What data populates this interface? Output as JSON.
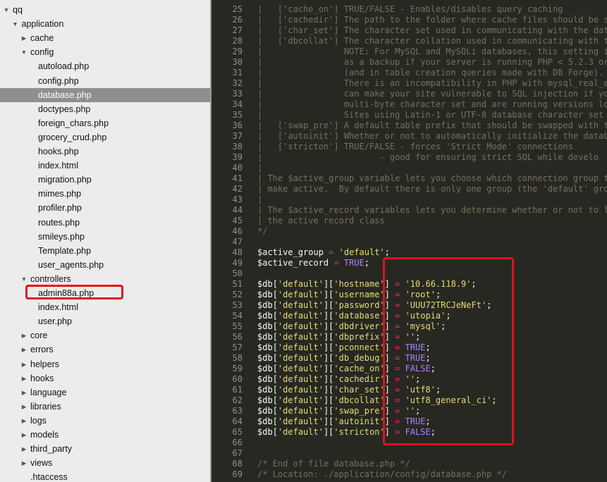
{
  "sidebar": {
    "rows": [
      {
        "label": "qq",
        "tri": "open",
        "depth": 0
      },
      {
        "label": "application",
        "tri": "open",
        "depth": 1
      },
      {
        "label": "cache",
        "tri": "closed",
        "depth": 2
      },
      {
        "label": "config",
        "tri": "open",
        "depth": 2
      },
      {
        "label": "autoload.php",
        "tri": "",
        "depth": 3
      },
      {
        "label": "config.php",
        "tri": "",
        "depth": 3
      },
      {
        "label": "database.php",
        "tri": "",
        "depth": 3,
        "selected": true
      },
      {
        "label": "doctypes.php",
        "tri": "",
        "depth": 3
      },
      {
        "label": "foreign_chars.php",
        "tri": "",
        "depth": 3
      },
      {
        "label": "grocery_crud.php",
        "tri": "",
        "depth": 3
      },
      {
        "label": "hooks.php",
        "tri": "",
        "depth": 3
      },
      {
        "label": "index.html",
        "tri": "",
        "depth": 3
      },
      {
        "label": "migration.php",
        "tri": "",
        "depth": 3
      },
      {
        "label": "mimes.php",
        "tri": "",
        "depth": 3
      },
      {
        "label": "profiler.php",
        "tri": "",
        "depth": 3
      },
      {
        "label": "routes.php",
        "tri": "",
        "depth": 3
      },
      {
        "label": "smileys.php",
        "tri": "",
        "depth": 3
      },
      {
        "label": "Template.php",
        "tri": "",
        "depth": 3
      },
      {
        "label": "user_agents.php",
        "tri": "",
        "depth": 3
      },
      {
        "label": "controllers",
        "tri": "open",
        "depth": 2
      },
      {
        "label": "admin88a.php",
        "tri": "",
        "depth": 3,
        "highlighted": true
      },
      {
        "label": "index.html",
        "tri": "",
        "depth": 3
      },
      {
        "label": "user.php",
        "tri": "",
        "depth": 3
      },
      {
        "label": "core",
        "tri": "closed",
        "depth": 2
      },
      {
        "label": "errors",
        "tri": "closed",
        "depth": 2
      },
      {
        "label": "helpers",
        "tri": "closed",
        "depth": 2
      },
      {
        "label": "hooks",
        "tri": "closed",
        "depth": 2
      },
      {
        "label": "language",
        "tri": "closed",
        "depth": 2
      },
      {
        "label": "libraries",
        "tri": "closed",
        "depth": 2
      },
      {
        "label": "logs",
        "tri": "closed",
        "depth": 2
      },
      {
        "label": "models",
        "tri": "closed",
        "depth": 2
      },
      {
        "label": "third_party",
        "tri": "closed",
        "depth": 2
      },
      {
        "label": "views",
        "tri": "closed",
        "depth": 2
      },
      {
        "label": ".htaccess",
        "tri": "",
        "depth": 2
      }
    ]
  },
  "editor": {
    "lines": [
      {
        "n": "25",
        "segs": [
          [
            "c",
            "|   ['cache_on'] TRUE/FALSE - Enables/disables query caching"
          ]
        ]
      },
      {
        "n": "26",
        "segs": [
          [
            "c",
            "|   ['cachedir'] The path to the folder where cache files should be sto"
          ]
        ]
      },
      {
        "n": "27",
        "segs": [
          [
            "c",
            "|   ['char_set'] The character set used in communicating with the datab"
          ]
        ]
      },
      {
        "n": "28",
        "segs": [
          [
            "c",
            "|   ['dbcollat'] The character collation used in communicating with the"
          ]
        ]
      },
      {
        "n": "29",
        "segs": [
          [
            "c",
            "|                NOTE: For MySQL and MySQLi databases, this setting is"
          ]
        ]
      },
      {
        "n": "30",
        "segs": [
          [
            "c",
            "|                as a backup if your server is running PHP < 5.2.3 or M"
          ]
        ]
      },
      {
        "n": "31",
        "segs": [
          [
            "c",
            "|                (and in table creation queries made with DB Forge)."
          ]
        ]
      },
      {
        "n": "32",
        "segs": [
          [
            "c",
            "|                There is an incompatibility in PHP with mysql_real_esc"
          ]
        ]
      },
      {
        "n": "33",
        "segs": [
          [
            "c",
            "|                can make your site vulnerable to SQL injection if you"
          ]
        ]
      },
      {
        "n": "34",
        "segs": [
          [
            "c",
            "|                multi-byte character set and are running versions lowe"
          ]
        ]
      },
      {
        "n": "35",
        "segs": [
          [
            "c",
            "|                Sites using Latin-1 or UTF-8 database character set an"
          ]
        ]
      },
      {
        "n": "36",
        "segs": [
          [
            "c",
            "|   ['swap_pre'] A default table prefix that should be swapped with the"
          ]
        ]
      },
      {
        "n": "37",
        "segs": [
          [
            "c",
            "|   ['autoinit'] Whether or not to automatically initialize the databas"
          ]
        ]
      },
      {
        "n": "38",
        "segs": [
          [
            "c",
            "|   ['stricton'] TRUE/FALSE - forces 'Strict Mode' connections"
          ]
        ]
      },
      {
        "n": "39",
        "segs": [
          [
            "c",
            "|                       - good for ensuring strict SQL while develo"
          ]
        ]
      },
      {
        "n": "40",
        "segs": [
          [
            "c",
            "|"
          ]
        ]
      },
      {
        "n": "41",
        "segs": [
          [
            "c",
            "| The $active_group variable lets you choose which connection group to"
          ]
        ]
      },
      {
        "n": "42",
        "segs": [
          [
            "c",
            "| make active.  By default there is only one group (the 'default' group"
          ]
        ]
      },
      {
        "n": "43",
        "segs": [
          [
            "c",
            "|"
          ]
        ]
      },
      {
        "n": "44",
        "segs": [
          [
            "c",
            "| The $active_record variables lets you determine whether or not to loa"
          ]
        ]
      },
      {
        "n": "45",
        "segs": [
          [
            "c",
            "| the active record class"
          ]
        ]
      },
      {
        "n": "46",
        "segs": [
          [
            "c",
            "*/"
          ]
        ]
      },
      {
        "n": "47",
        "segs": []
      },
      {
        "n": "48",
        "segs": [
          [
            "v",
            "$active_group "
          ],
          [
            "o",
            "="
          ],
          [
            "p",
            " "
          ],
          [
            "s",
            "'default'"
          ],
          [
            "p",
            ";"
          ]
        ]
      },
      {
        "n": "49",
        "segs": [
          [
            "v",
            "$active_record "
          ],
          [
            "o",
            "="
          ],
          [
            "p",
            " "
          ],
          [
            "k",
            "TRUE"
          ],
          [
            "p",
            ";"
          ]
        ]
      },
      {
        "n": "50",
        "segs": []
      },
      {
        "n": "51",
        "segs": [
          [
            "v",
            "$db"
          ],
          [
            "p",
            "["
          ],
          [
            "s",
            "'default'"
          ],
          [
            "p",
            "]["
          ],
          [
            "s",
            "'hostname'"
          ],
          [
            "p",
            "] "
          ],
          [
            "o",
            "="
          ],
          [
            "p",
            " "
          ],
          [
            "s",
            "'10.66.118.9'"
          ],
          [
            "p",
            ";"
          ]
        ]
      },
      {
        "n": "52",
        "segs": [
          [
            "v",
            "$db"
          ],
          [
            "p",
            "["
          ],
          [
            "s",
            "'default'"
          ],
          [
            "p",
            "]["
          ],
          [
            "s",
            "'username'"
          ],
          [
            "p",
            "] "
          ],
          [
            "o",
            "="
          ],
          [
            "p",
            " "
          ],
          [
            "s",
            "'root'"
          ],
          [
            "p",
            ";"
          ]
        ]
      },
      {
        "n": "53",
        "segs": [
          [
            "v",
            "$db"
          ],
          [
            "p",
            "["
          ],
          [
            "s",
            "'default'"
          ],
          [
            "p",
            "]["
          ],
          [
            "s",
            "'password'"
          ],
          [
            "p",
            "] "
          ],
          [
            "o",
            "="
          ],
          [
            "p",
            " "
          ],
          [
            "s",
            "'UUU72TRCJeNeFt'"
          ],
          [
            "p",
            ";"
          ]
        ]
      },
      {
        "n": "54",
        "segs": [
          [
            "v",
            "$db"
          ],
          [
            "p",
            "["
          ],
          [
            "s",
            "'default'"
          ],
          [
            "p",
            "]["
          ],
          [
            "s",
            "'database'"
          ],
          [
            "p",
            "] "
          ],
          [
            "o",
            "="
          ],
          [
            "p",
            " "
          ],
          [
            "s",
            "'utopia'"
          ],
          [
            "p",
            ";"
          ]
        ]
      },
      {
        "n": "55",
        "segs": [
          [
            "v",
            "$db"
          ],
          [
            "p",
            "["
          ],
          [
            "s",
            "'default'"
          ],
          [
            "p",
            "]["
          ],
          [
            "s",
            "'dbdriver'"
          ],
          [
            "p",
            "] "
          ],
          [
            "o",
            "="
          ],
          [
            "p",
            " "
          ],
          [
            "s",
            "'mysql'"
          ],
          [
            "p",
            ";"
          ]
        ]
      },
      {
        "n": "56",
        "segs": [
          [
            "v",
            "$db"
          ],
          [
            "p",
            "["
          ],
          [
            "s",
            "'default'"
          ],
          [
            "p",
            "]["
          ],
          [
            "s",
            "'dbprefix'"
          ],
          [
            "p",
            "] "
          ],
          [
            "o",
            "="
          ],
          [
            "p",
            " "
          ],
          [
            "s",
            "''"
          ],
          [
            "p",
            ";"
          ]
        ]
      },
      {
        "n": "57",
        "segs": [
          [
            "v",
            "$db"
          ],
          [
            "p",
            "["
          ],
          [
            "s",
            "'default'"
          ],
          [
            "p",
            "]["
          ],
          [
            "s",
            "'pconnect'"
          ],
          [
            "p",
            "] "
          ],
          [
            "o",
            "="
          ],
          [
            "p",
            " "
          ],
          [
            "k",
            "TRUE"
          ],
          [
            "p",
            ";"
          ]
        ]
      },
      {
        "n": "58",
        "segs": [
          [
            "v",
            "$db"
          ],
          [
            "p",
            "["
          ],
          [
            "s",
            "'default'"
          ],
          [
            "p",
            "]["
          ],
          [
            "s",
            "'db_debug'"
          ],
          [
            "p",
            "] "
          ],
          [
            "o",
            "="
          ],
          [
            "p",
            " "
          ],
          [
            "k",
            "TRUE"
          ],
          [
            "p",
            ";"
          ]
        ]
      },
      {
        "n": "59",
        "segs": [
          [
            "v",
            "$db"
          ],
          [
            "p",
            "["
          ],
          [
            "s",
            "'default'"
          ],
          [
            "p",
            "]["
          ],
          [
            "s",
            "'cache_on'"
          ],
          [
            "p",
            "] "
          ],
          [
            "o",
            "="
          ],
          [
            "p",
            " "
          ],
          [
            "k",
            "FALSE"
          ],
          [
            "p",
            ";"
          ]
        ]
      },
      {
        "n": "60",
        "segs": [
          [
            "v",
            "$db"
          ],
          [
            "p",
            "["
          ],
          [
            "s",
            "'default'"
          ],
          [
            "p",
            "]["
          ],
          [
            "s",
            "'cachedir'"
          ],
          [
            "p",
            "] "
          ],
          [
            "o",
            "="
          ],
          [
            "p",
            " "
          ],
          [
            "s",
            "''"
          ],
          [
            "p",
            ";"
          ]
        ]
      },
      {
        "n": "61",
        "segs": [
          [
            "v",
            "$db"
          ],
          [
            "p",
            "["
          ],
          [
            "s",
            "'default'"
          ],
          [
            "p",
            "]["
          ],
          [
            "s",
            "'char_set'"
          ],
          [
            "p",
            "] "
          ],
          [
            "o",
            "="
          ],
          [
            "p",
            " "
          ],
          [
            "s",
            "'utf8'"
          ],
          [
            "p",
            ";"
          ]
        ]
      },
      {
        "n": "62",
        "segs": [
          [
            "v",
            "$db"
          ],
          [
            "p",
            "["
          ],
          [
            "s",
            "'default'"
          ],
          [
            "p",
            "]["
          ],
          [
            "s",
            "'dbcollat'"
          ],
          [
            "p",
            "] "
          ],
          [
            "o",
            "="
          ],
          [
            "p",
            " "
          ],
          [
            "s",
            "'utf8_general_ci'"
          ],
          [
            "p",
            ";"
          ]
        ]
      },
      {
        "n": "63",
        "segs": [
          [
            "v",
            "$db"
          ],
          [
            "p",
            "["
          ],
          [
            "s",
            "'default'"
          ],
          [
            "p",
            "]["
          ],
          [
            "s",
            "'swap_pre'"
          ],
          [
            "p",
            "] "
          ],
          [
            "o",
            "="
          ],
          [
            "p",
            " "
          ],
          [
            "s",
            "''"
          ],
          [
            "p",
            ";"
          ]
        ]
      },
      {
        "n": "64",
        "segs": [
          [
            "v",
            "$db"
          ],
          [
            "p",
            "["
          ],
          [
            "s",
            "'default'"
          ],
          [
            "p",
            "]["
          ],
          [
            "s",
            "'autoinit'"
          ],
          [
            "p",
            "] "
          ],
          [
            "o",
            "="
          ],
          [
            "p",
            " "
          ],
          [
            "k",
            "TRUE"
          ],
          [
            "p",
            ";"
          ]
        ]
      },
      {
        "n": "65",
        "segs": [
          [
            "v",
            "$db"
          ],
          [
            "p",
            "["
          ],
          [
            "s",
            "'default'"
          ],
          [
            "p",
            "]["
          ],
          [
            "s",
            "'stricton'"
          ],
          [
            "p",
            "] "
          ],
          [
            "o",
            "="
          ],
          [
            "p",
            " "
          ],
          [
            "k",
            "FALSE"
          ],
          [
            "p",
            ";"
          ]
        ]
      },
      {
        "n": "66",
        "segs": []
      },
      {
        "n": "67",
        "segs": []
      },
      {
        "n": "68",
        "segs": [
          [
            "c",
            "/* End of file database.php */"
          ]
        ]
      },
      {
        "n": "69",
        "segs": [
          [
            "c",
            "/* Location: ./application/config/database.php */"
          ]
        ]
      }
    ]
  },
  "colors": {
    "editor_bg": "#272822",
    "comment": "#75715e",
    "string": "#e6db74",
    "operator": "#f92672",
    "constant": "#ae81ff",
    "annotation_red": "#e0121b"
  }
}
